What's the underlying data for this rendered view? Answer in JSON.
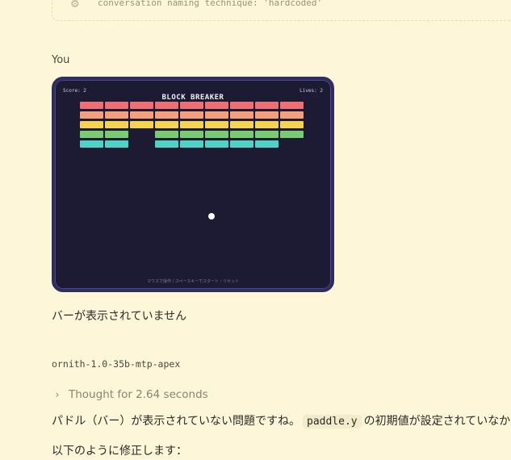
{
  "top_card": {
    "icon": "gear-icon",
    "text": "conversation naming technique: 'hardcoded'"
  },
  "message": {
    "sender": "You",
    "text": "バーが表示されていません"
  },
  "game": {
    "score": "Score: 2",
    "lives": "Lives: 2",
    "title": "BLOCK BREAKER",
    "hint": "マウスで操作 / スペースキーでスタート・リセット",
    "brick_rows": [
      {
        "color": "#ef6f73",
        "present": [
          1,
          1,
          1,
          1,
          1,
          1,
          1,
          1,
          1
        ]
      },
      {
        "color": "#f4a07c",
        "present": [
          1,
          1,
          1,
          1,
          1,
          1,
          1,
          1,
          1
        ]
      },
      {
        "color": "#f5d44f",
        "present": [
          1,
          1,
          1,
          1,
          1,
          1,
          1,
          1,
          1
        ]
      },
      {
        "color": "#79cc72",
        "present": [
          1,
          1,
          0,
          1,
          1,
          1,
          1,
          1,
          1
        ]
      },
      {
        "color": "#4fd2c6",
        "present": [
          1,
          1,
          0,
          1,
          1,
          1,
          1,
          1,
          0
        ]
      }
    ]
  },
  "response": {
    "model": "ornith-1.0-35b-mtp-apex",
    "thought_label": "Thought for 2.64 seconds",
    "line1_before": "パドル（バー）が表示されていない問題ですね。",
    "line1_code": "paddle.y",
    "line1_after": "の初期値が設定されていなかっ",
    "line2": "以下のように修正します："
  }
}
